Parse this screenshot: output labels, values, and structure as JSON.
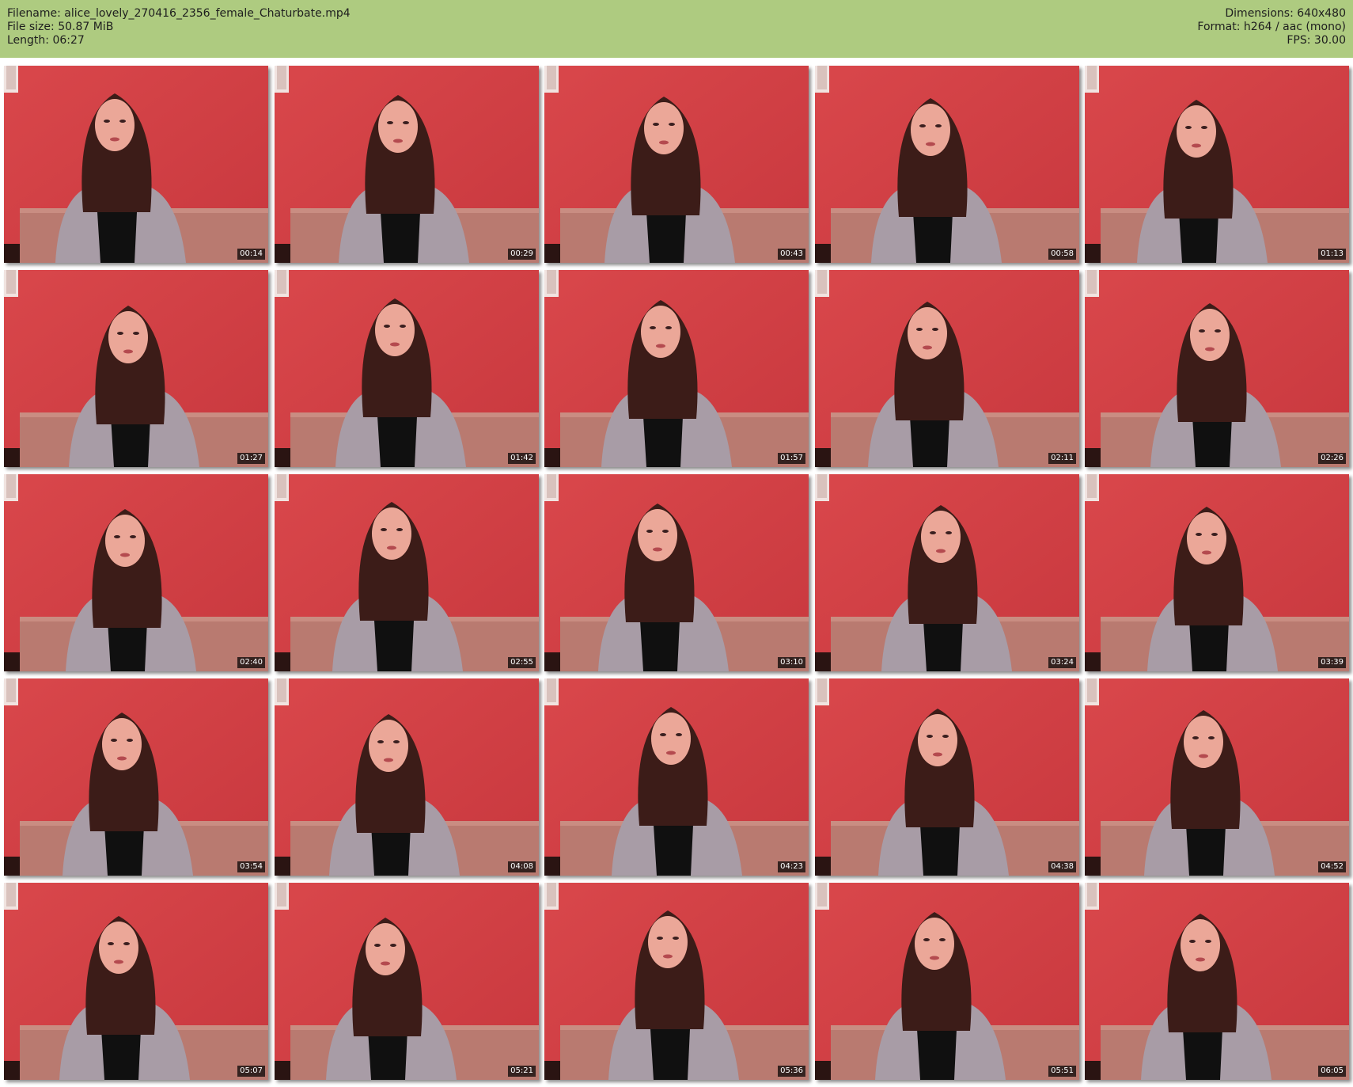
{
  "header": {
    "filename_line": "Filename: alice_lovely_270416_2356_female_Chaturbate.mp4",
    "filesize_line": "File size: 50.87 MiB",
    "length_line": "Length: 06:27",
    "dimensions_line": "Dimensions: 640x480",
    "format_line": "Format: h264 / aac (mono)",
    "fps_line": "FPS: 30.00"
  },
  "colors": {
    "header_bg": "#aecb80",
    "wall": "#c8383e",
    "sweater": "#a89ca6",
    "hair": "#3c1c18"
  },
  "thumbnails": [
    {
      "timestamp": "00:14"
    },
    {
      "timestamp": "00:29"
    },
    {
      "timestamp": "00:43"
    },
    {
      "timestamp": "00:58"
    },
    {
      "timestamp": "01:13"
    },
    {
      "timestamp": "01:27"
    },
    {
      "timestamp": "01:42"
    },
    {
      "timestamp": "01:57"
    },
    {
      "timestamp": "02:11"
    },
    {
      "timestamp": "02:26"
    },
    {
      "timestamp": "02:40"
    },
    {
      "timestamp": "02:55"
    },
    {
      "timestamp": "03:10"
    },
    {
      "timestamp": "03:24"
    },
    {
      "timestamp": "03:39"
    },
    {
      "timestamp": "03:54"
    },
    {
      "timestamp": "04:08"
    },
    {
      "timestamp": "04:23"
    },
    {
      "timestamp": "04:38"
    },
    {
      "timestamp": "04:52"
    },
    {
      "timestamp": "05:07"
    },
    {
      "timestamp": "05:21"
    },
    {
      "timestamp": "05:36"
    },
    {
      "timestamp": "05:51"
    },
    {
      "timestamp": "06:05"
    }
  ]
}
